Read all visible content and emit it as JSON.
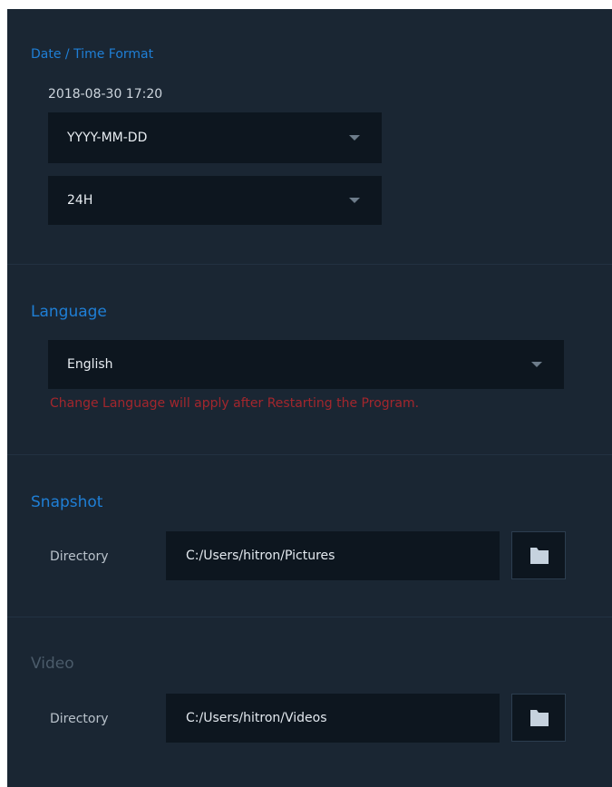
{
  "date_time": {
    "title": "Date / Time Format",
    "preview": "2018-08-30 17:20",
    "date_format": "YYYY-MM-DD",
    "time_format": "24H"
  },
  "language": {
    "title": "Language",
    "selected": "English",
    "warning": "Change Language will apply after Restarting the Program."
  },
  "snapshot": {
    "title": "Snapshot",
    "directory_label": "Directory",
    "directory_value": "C:/Users/hitron/Pictures"
  },
  "video": {
    "title": "Video",
    "directory_label": "Directory",
    "directory_value": "C:/Users/hitron/Videos"
  },
  "colors": {
    "panel_bg": "#1a2633",
    "field_bg": "#0d161f",
    "accent_title": "#1f7fd6",
    "muted_title": "#4b5b6a",
    "warning": "#a3262d"
  },
  "icons": {
    "dropdown": "caret-down-icon",
    "browse": "folder-icon"
  }
}
